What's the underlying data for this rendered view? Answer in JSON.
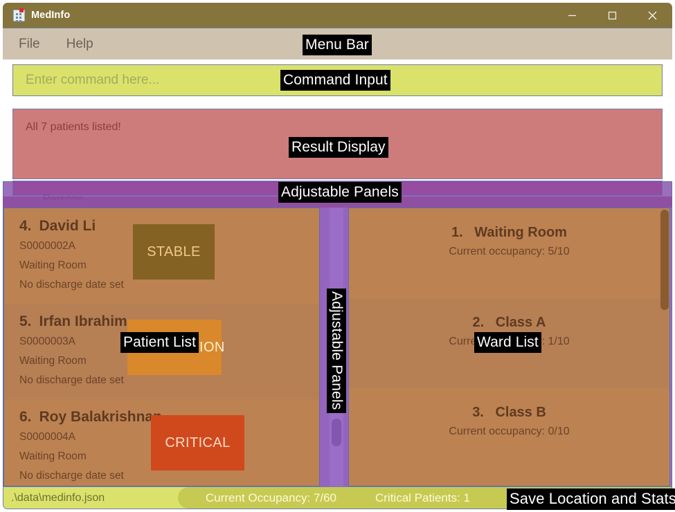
{
  "window": {
    "title": "MedInfo",
    "icon": "hospital-icon",
    "controls": {
      "minimize": "minimize-icon",
      "maximize": "maximize-icon",
      "close": "close-icon"
    },
    "colors": {
      "titlebar": "#85743b",
      "menubar": "#cfc2ae",
      "command": "#dae26b",
      "result": "#ce7b7b",
      "panels": "#9c6fbd",
      "card": "#bd8252",
      "statusbar": "#dae26b"
    }
  },
  "menubar": {
    "items": [
      {
        "label": "File"
      },
      {
        "label": "Help"
      }
    ]
  },
  "command": {
    "placeholder": "Enter command here...",
    "value": ""
  },
  "result": {
    "text": "All 7 patients listed!"
  },
  "patient_list": {
    "patients": [
      {
        "index": "4.",
        "name": "David Li",
        "id": "S0000002A",
        "ward": "Waiting Room",
        "discharge": "No discharge date set",
        "status": "STABLE",
        "status_color": "#846224"
      },
      {
        "index": "5.",
        "name": "Irfan Ibrahim",
        "id": "S0000003A",
        "ward": "Waiting Room",
        "discharge": "No discharge date set",
        "status": "OBSERVATION",
        "status_color": "#d9882b"
      },
      {
        "index": "6.",
        "name": "Roy Balakrishnan",
        "id": "S0000004A",
        "ward": "Waiting Room",
        "discharge": "No discharge date set",
        "status": "CRITICAL",
        "status_color": "#d0491d"
      }
    ]
  },
  "ward_list": {
    "wards": [
      {
        "index": "1.",
        "name": "Waiting Room",
        "occupancy": "Current occupancy: 5/10"
      },
      {
        "index": "2.",
        "name": "Class A",
        "occupancy": "Current occupancy: 1/10"
      },
      {
        "index": "3.",
        "name": "Class B",
        "occupancy": "Current occupancy: 0/10"
      }
    ]
  },
  "statusbar": {
    "save_path": ".\\data\\medinfo.json",
    "occupancy": "Current Occupancy: 7/60",
    "critical": "Critical Patients: 1"
  },
  "annotations": {
    "menu_bar": "Menu Bar",
    "command_input": "Command Input",
    "result_display": "Result Display",
    "adjustable_panels": "Adjustable Panels",
    "adjustable_panels_vertical": "Adjustable Panels",
    "patient_list": "Patient List",
    "ward_list": "Ward List",
    "save_location": "Save Location and Stats"
  }
}
